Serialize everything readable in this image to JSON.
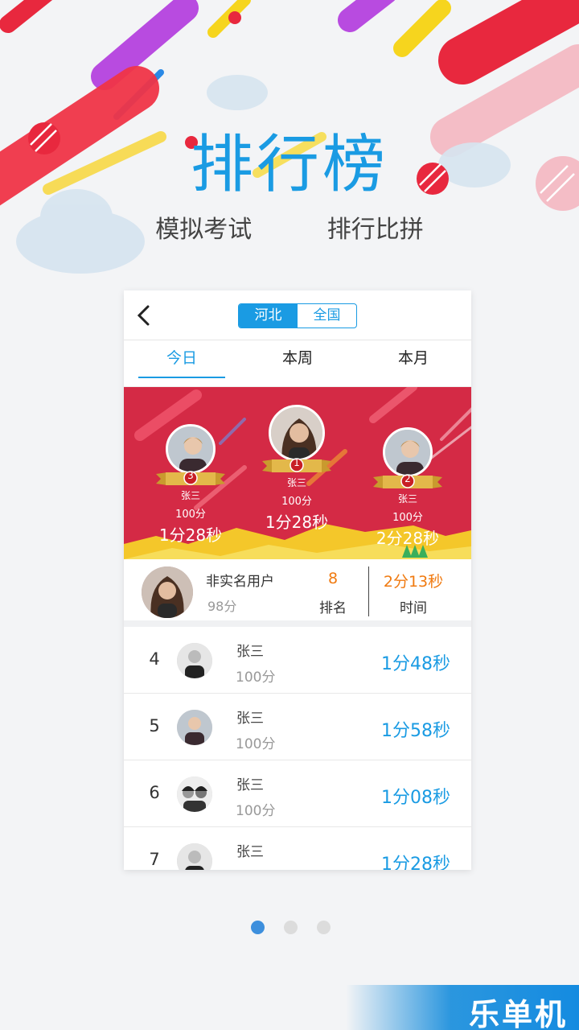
{
  "hero": {
    "title": "排行榜",
    "subtitle_left": "模拟考试",
    "subtitle_right": "排行比拼"
  },
  "topbar": {
    "back_icon": "chevron-left-icon",
    "segments": [
      "河北",
      "全国"
    ],
    "active_segment": "河北"
  },
  "tabs": [
    {
      "label": "今日",
      "active": true
    },
    {
      "label": "本周",
      "active": false
    },
    {
      "label": "本月",
      "active": false
    }
  ],
  "podium": [
    {
      "rank": "3",
      "name": "张三",
      "score": "100分",
      "time": "1分28秒"
    },
    {
      "rank": "1",
      "name": "张三",
      "score": "100分",
      "time": "1分28秒"
    },
    {
      "rank": "2",
      "name": "张三",
      "score": "100分",
      "time": "2分28秒"
    }
  ],
  "me": {
    "name": "非实名用户",
    "score": "98分",
    "rank_value": "8",
    "rank_label": "排名",
    "time_value": "2分13秒",
    "time_label": "时间"
  },
  "ranking": [
    {
      "rank": "4",
      "name": "张三",
      "score": "100分",
      "time": "1分48秒"
    },
    {
      "rank": "5",
      "name": "张三",
      "score": "100分",
      "time": "1分58秒"
    },
    {
      "rank": "6",
      "name": "张三",
      "score": "100分",
      "time": "1分08秒"
    },
    {
      "rank": "7",
      "name": "张三",
      "score": "",
      "time": "1分28秒"
    }
  ],
  "pager": {
    "count": 3,
    "active_index": 0
  },
  "watermark": "乐单机",
  "colors": {
    "accent": "#1a9be3",
    "podium_bg": "#d42a45",
    "highlight": "#f07a10"
  }
}
